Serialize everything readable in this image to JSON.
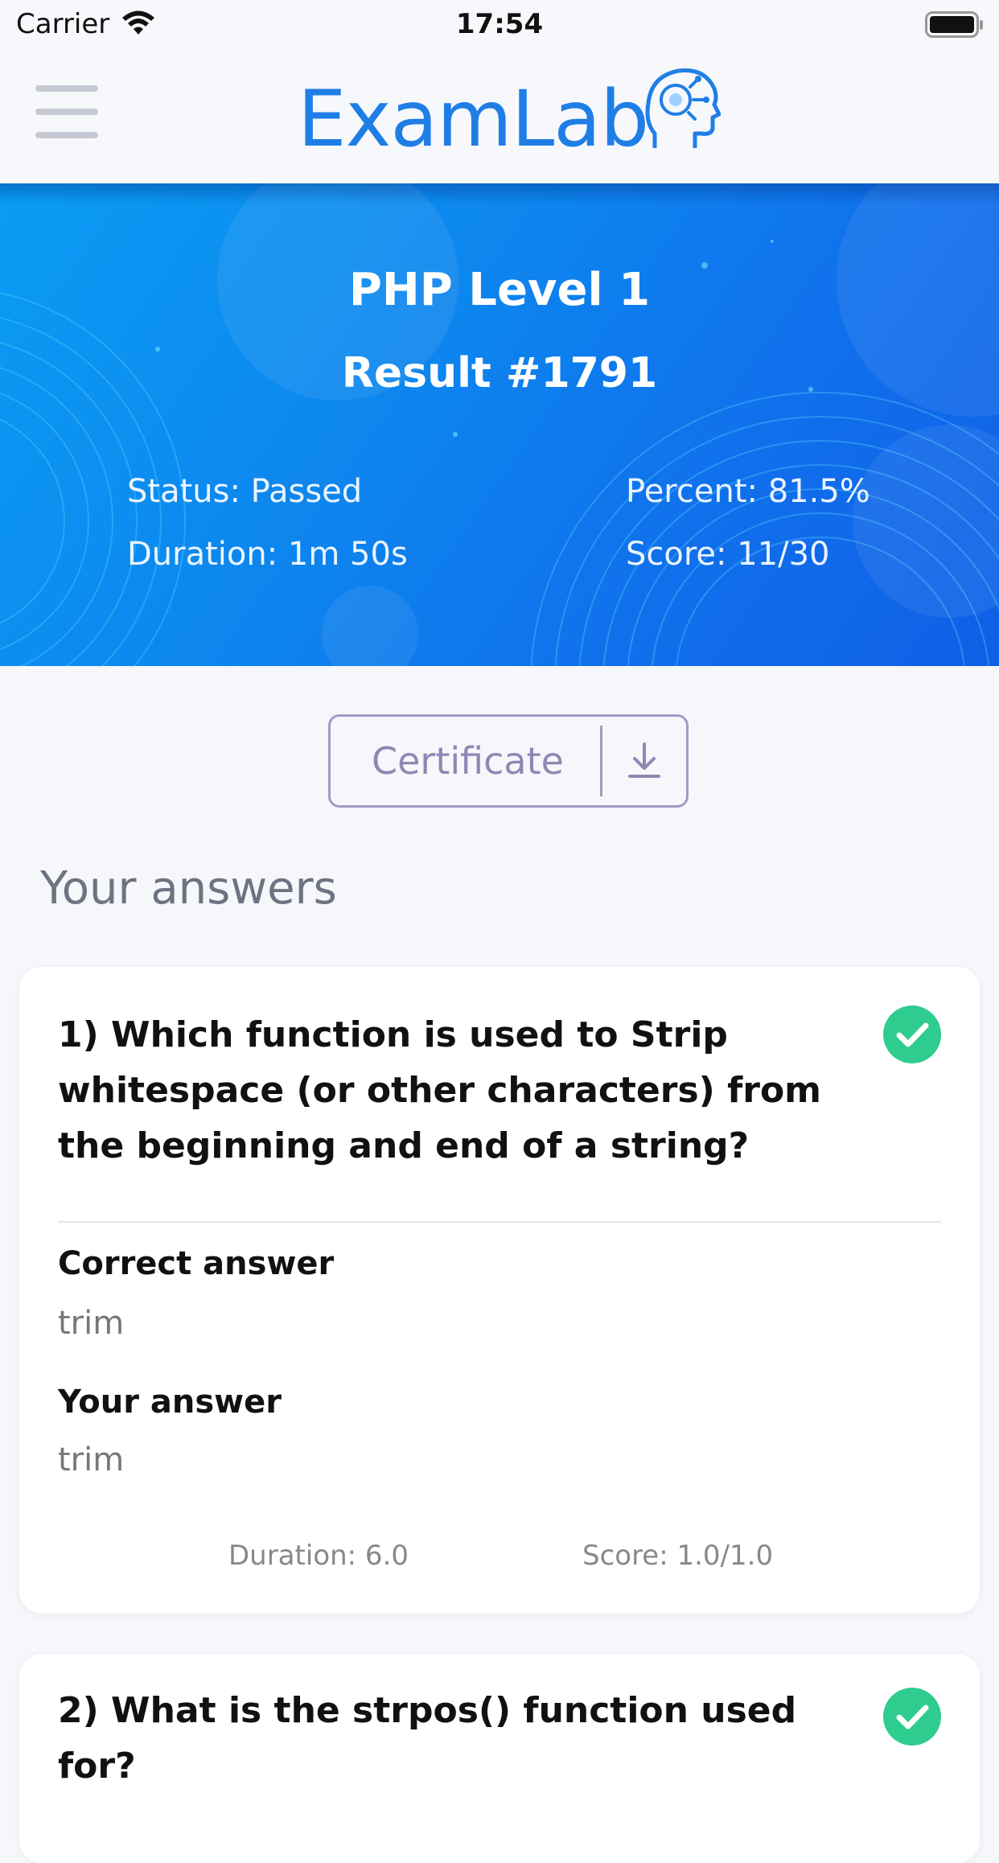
{
  "status_bar": {
    "carrier": "Carrier",
    "time": "17:54"
  },
  "header": {
    "logo_text": "ExamLab",
    "menu_icon": "hamburger-menu-icon",
    "brand_color": "#1f7ee6"
  },
  "result": {
    "exam_title": "PHP Level 1",
    "result_label": "Result #1791",
    "status": "Status: Passed",
    "duration": "Duration: 1m 50s",
    "percent": "Percent: 81.5%",
    "score": "Score: 11/30"
  },
  "certificate": {
    "label": "Certificate",
    "icon": "download-icon"
  },
  "answers_section": {
    "title": "Your answers",
    "items": [
      {
        "question": "1) Which function is used to Strip whitespace (or other characters) from the beginning and end of a string?",
        "correct_label": "Correct answer",
        "correct_value": "trim",
        "your_label": "Your answer",
        "your_value": "trim",
        "duration": "Duration: 6.0",
        "score": "Score: 1.0/1.0",
        "status_icon": "check-circle-icon"
      },
      {
        "question": "2) What is the strpos() function used for?",
        "status_icon": "check-circle-icon"
      }
    ]
  },
  "colors": {
    "success": "#2ecc8e",
    "banner_start": "#0a9cf4",
    "banner_end": "#0f5fe6",
    "certificate_border": "#a19bc4"
  }
}
